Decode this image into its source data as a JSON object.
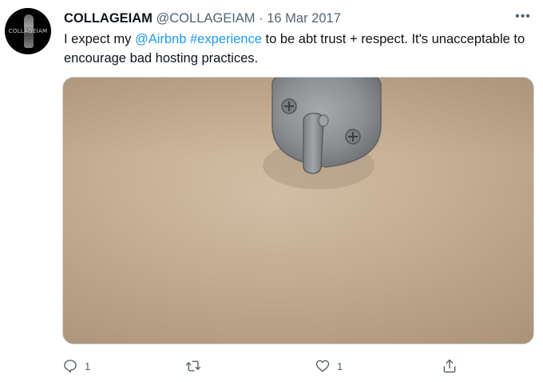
{
  "tweet": {
    "avatar_text": "COLLAGEIAM",
    "display_name": "COLLAGEIAM",
    "handle": "@COLLAGEIAM",
    "separator": "·",
    "date": "16 Mar 2017",
    "more_label": "•••",
    "text": {
      "before": "I expect my ",
      "mention": "@Airbnb",
      "space": " ",
      "hashtag": "#experience",
      "after": " to be abt trust + respect. It's unacceptable to encourage bad hosting practices."
    },
    "media": {
      "description_icon": "photo"
    },
    "actions": {
      "reply_count": "1",
      "retweet_count": "",
      "like_count": "1"
    }
  },
  "colors": {
    "link": "#1d9bf0",
    "secondary_text": "#536471",
    "primary_text": "#0f1419"
  }
}
